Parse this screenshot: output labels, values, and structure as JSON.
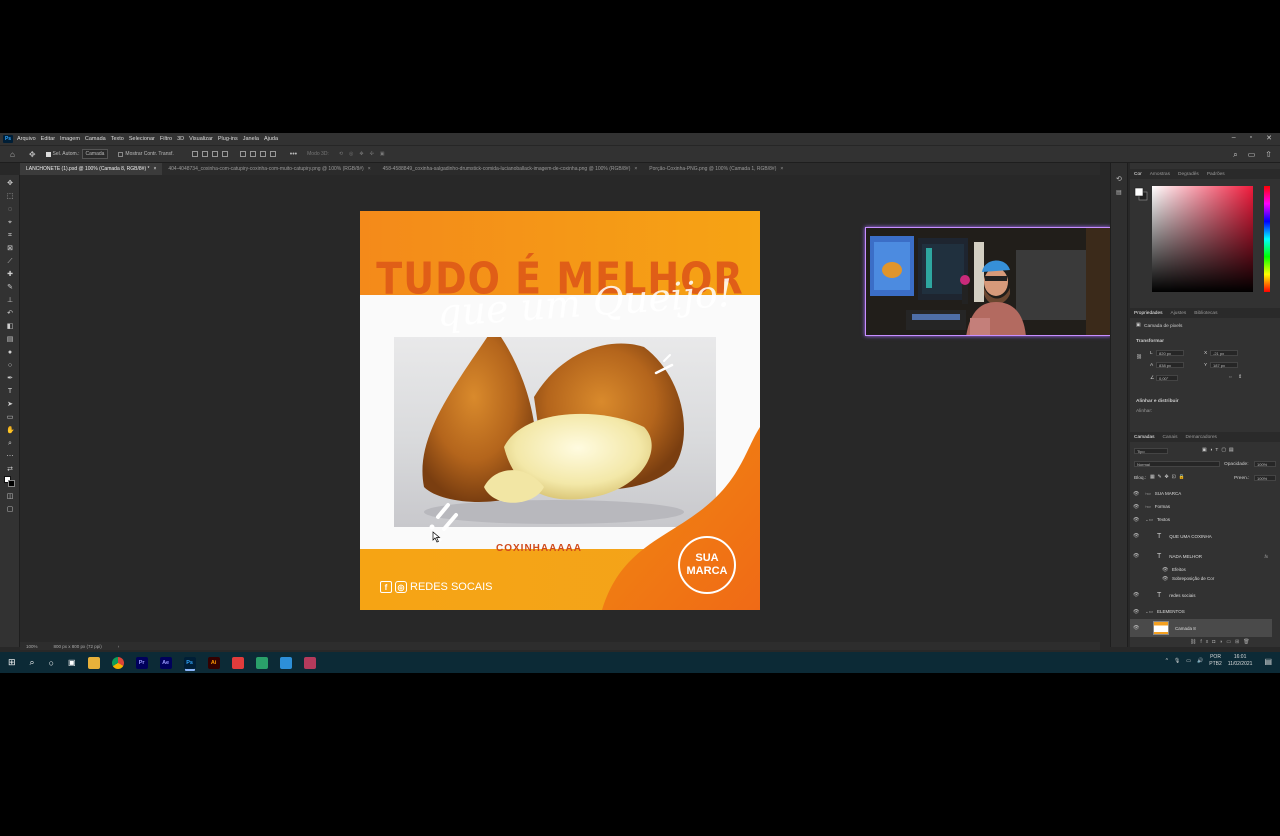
{
  "app": {
    "logo": "Ps",
    "menu": [
      "Arquivo",
      "Editar",
      "Imagem",
      "Camada",
      "Texto",
      "Selecionar",
      "Filtro",
      "3D",
      "Visualizar",
      "Plug-ins",
      "Janela",
      "Ajuda"
    ],
    "window_controls": [
      "–",
      "▫",
      "✕"
    ]
  },
  "options_bar": {
    "auto_select_label": "Sel. Autom.:",
    "auto_select_value": "Camada",
    "show_transform_label": "Mostrar Contr. Transf.",
    "mode_3d_label": "Modo 3D:",
    "more": "•••"
  },
  "tabs": [
    {
      "label": "LANCHONETE (1).psd @ 100% (Camada 8, RGB/8#) *",
      "active": true
    },
    {
      "label": "404-4048734_coxinha-com-catupiry-coxinha-com-muito-catupiry.png @ 100% (RGB/8#)",
      "active": false
    },
    {
      "label": "458-4588849_coxinha-salgadinho-drumstick-comida-lucianoballack-imagem-de-coxinha.png @ 100% (RGB/8#)",
      "active": false
    },
    {
      "label": "Porção-Coxinha-PNG.png @ 100% (Camada 1, RGB/8#)",
      "active": false
    }
  ],
  "artboard": {
    "headline": "TUDO É MELHOR",
    "script": "que um Queijo!",
    "subtext": "COXINHAAAAA",
    "brand_line1": "SUA",
    "brand_line2": "MARCA",
    "social_label": "REDES SOCAIS",
    "colors": {
      "orange": "#f48a1a",
      "deep_orange": "#f07a14",
      "headline": "#e05e17"
    }
  },
  "status": {
    "zoom": "100%",
    "doc_size": "800 px x 800 px (72 ppi)"
  },
  "color_panel": {
    "tabs": [
      "Cor",
      "Amostras",
      "Degradês",
      "Padrões"
    ],
    "active_tab": "Cor"
  },
  "properties_panel": {
    "tabs": [
      "Propriedades",
      "Ajustes",
      "Bibliotecas"
    ],
    "layer_type": "Camada de pixels",
    "transform_title": "Transformar",
    "l_value": "820 px",
    "x_value": "-21 px",
    "a_value": "838 px",
    "y_value": "187 px",
    "angle_value": "0,00°",
    "align_title": "Alinhar e distribuir",
    "align_label": "Alinhar:"
  },
  "layers_panel": {
    "tabs": [
      "Camadas",
      "Canais",
      "Demarcadores"
    ],
    "filter": "Tipo",
    "blend_mode": "Normal",
    "opacity_label": "Opacidade:",
    "opacity_value": "100%",
    "lock_label": "Bloq.:",
    "fill_label": "Preen.:",
    "fill_value": "100%",
    "layers": [
      {
        "name": "SUA MARCA",
        "kind": "group"
      },
      {
        "name": "Formas",
        "kind": "group"
      },
      {
        "name": "Textos",
        "kind": "group-open"
      },
      {
        "name": "QUE UMA COXINHA",
        "kind": "text"
      },
      {
        "name": "NADA MELHOR",
        "kind": "text",
        "fx": "fx"
      },
      {
        "name": "Efeitos",
        "kind": "effect"
      },
      {
        "name": "Sobreposição de Cor",
        "kind": "effect"
      },
      {
        "name": "redes sociais",
        "kind": "text"
      },
      {
        "name": "ELEMENTOS",
        "kind": "group-open"
      },
      {
        "name": "Camada 8",
        "kind": "pixel",
        "selected": true
      }
    ]
  },
  "taskbar": {
    "apps": [
      "Pr",
      "Ae",
      "Ps",
      "Ai"
    ],
    "lang": "POR",
    "lang2": "PTB2",
    "time": "16:01",
    "date": "11/02/2021"
  }
}
